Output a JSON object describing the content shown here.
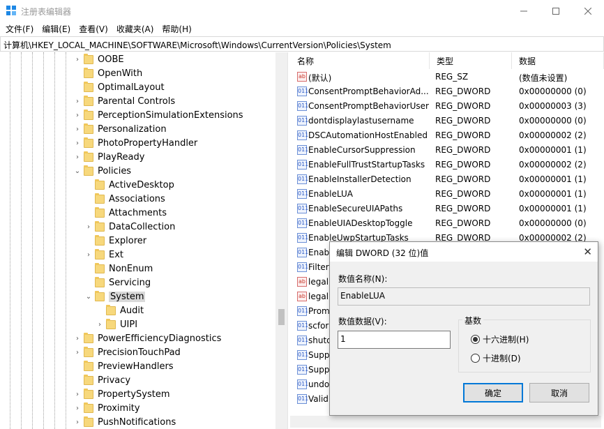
{
  "window": {
    "title": "注册表编辑器"
  },
  "menu": [
    "文件(F)",
    "编辑(E)",
    "查看(V)",
    "收藏夹(A)",
    "帮助(H)"
  ],
  "address": "计算机\\HKEY_LOCAL_MACHINE\\SOFTWARE\\Microsoft\\Windows\\CurrentVersion\\Policies\\System",
  "tree": [
    {
      "label": "OOBE",
      "level": 0,
      "chevron": "right"
    },
    {
      "label": "OpenWith",
      "level": 0,
      "chevron": ""
    },
    {
      "label": "OptimalLayout",
      "level": 0,
      "chevron": ""
    },
    {
      "label": "Parental Controls",
      "level": 0,
      "chevron": "right"
    },
    {
      "label": "PerceptionSimulationExtensions",
      "level": 0,
      "chevron": "right"
    },
    {
      "label": "Personalization",
      "level": 0,
      "chevron": "right"
    },
    {
      "label": "PhotoPropertyHandler",
      "level": 0,
      "chevron": "right"
    },
    {
      "label": "PlayReady",
      "level": 0,
      "chevron": "right"
    },
    {
      "label": "Policies",
      "level": 0,
      "chevron": "down"
    },
    {
      "label": "ActiveDesktop",
      "level": 1,
      "chevron": ""
    },
    {
      "label": "Associations",
      "level": 1,
      "chevron": ""
    },
    {
      "label": "Attachments",
      "level": 1,
      "chevron": ""
    },
    {
      "label": "DataCollection",
      "level": 1,
      "chevron": "right"
    },
    {
      "label": "Explorer",
      "level": 1,
      "chevron": ""
    },
    {
      "label": "Ext",
      "level": 1,
      "chevron": "right"
    },
    {
      "label": "NonEnum",
      "level": 1,
      "chevron": ""
    },
    {
      "label": "Servicing",
      "level": 1,
      "chevron": ""
    },
    {
      "label": "System",
      "level": 1,
      "chevron": "down",
      "selected": true
    },
    {
      "label": "Audit",
      "level": 2,
      "chevron": ""
    },
    {
      "label": "UIPI",
      "level": 2,
      "chevron": "right"
    },
    {
      "label": "PowerEfficiencyDiagnostics",
      "level": 0,
      "chevron": "right"
    },
    {
      "label": "PrecisionTouchPad",
      "level": 0,
      "chevron": "right"
    },
    {
      "label": "PreviewHandlers",
      "level": 0,
      "chevron": ""
    },
    {
      "label": "Privacy",
      "level": 0,
      "chevron": ""
    },
    {
      "label": "PropertySystem",
      "level": 0,
      "chevron": "right"
    },
    {
      "label": "Proximity",
      "level": 0,
      "chevron": "right"
    },
    {
      "label": "PushNotifications",
      "level": 0,
      "chevron": "right"
    }
  ],
  "list": {
    "headers": {
      "name": "名称",
      "type": "类型",
      "data": "数据"
    },
    "rows": [
      {
        "name": "(默认)",
        "type": "REG_SZ",
        "data": "(数值未设置)",
        "icon": "ab"
      },
      {
        "name": "ConsentPromptBehaviorAd...",
        "type": "REG_DWORD",
        "data": "0x00000000 (0)",
        "icon": "dw"
      },
      {
        "name": "ConsentPromptBehaviorUser",
        "type": "REG_DWORD",
        "data": "0x00000003 (3)",
        "icon": "dw"
      },
      {
        "name": "dontdisplaylastusername",
        "type": "REG_DWORD",
        "data": "0x00000000 (0)",
        "icon": "dw"
      },
      {
        "name": "DSCAutomationHostEnabled",
        "type": "REG_DWORD",
        "data": "0x00000002 (2)",
        "icon": "dw"
      },
      {
        "name": "EnableCursorSuppression",
        "type": "REG_DWORD",
        "data": "0x00000001 (1)",
        "icon": "dw"
      },
      {
        "name": "EnableFullTrustStartupTasks",
        "type": "REG_DWORD",
        "data": "0x00000002 (2)",
        "icon": "dw"
      },
      {
        "name": "EnableInstallerDetection",
        "type": "REG_DWORD",
        "data": "0x00000001 (1)",
        "icon": "dw"
      },
      {
        "name": "EnableLUA",
        "type": "REG_DWORD",
        "data": "0x00000001 (1)",
        "icon": "dw"
      },
      {
        "name": "EnableSecureUIAPaths",
        "type": "REG_DWORD",
        "data": "0x00000001 (1)",
        "icon": "dw"
      },
      {
        "name": "EnableUIADesktopToggle",
        "type": "REG_DWORD",
        "data": "0x00000000 (0)",
        "icon": "dw"
      },
      {
        "name": "EnableUwpStartupTasks",
        "type": "REG_DWORD",
        "data": "0x00000002 (2)",
        "icon": "dw"
      },
      {
        "name": "Enab",
        "type": "",
        "data": "",
        "icon": "dw"
      },
      {
        "name": "Filter",
        "type": "",
        "data": "",
        "icon": "dw"
      },
      {
        "name": "legal",
        "type": "",
        "data": "",
        "icon": "ab"
      },
      {
        "name": "legal",
        "type": "",
        "data": "",
        "icon": "ab"
      },
      {
        "name": "Prom",
        "type": "",
        "data": "",
        "icon": "dw"
      },
      {
        "name": "scfor",
        "type": "",
        "data": "",
        "icon": "dw"
      },
      {
        "name": "shutd",
        "type": "",
        "data": "",
        "icon": "dw"
      },
      {
        "name": "Supp",
        "type": "",
        "data": "",
        "icon": "dw"
      },
      {
        "name": "Supp",
        "type": "",
        "data": "",
        "icon": "dw"
      },
      {
        "name": "undo",
        "type": "",
        "data": "",
        "icon": "dw"
      },
      {
        "name": "Valid",
        "type": "",
        "data": "",
        "icon": "dw"
      }
    ]
  },
  "dialog": {
    "title": "编辑 DWORD (32 位)值",
    "name_label": "数值名称(N):",
    "name_value": "EnableLUA",
    "data_label": "数值数据(V):",
    "data_value": "1",
    "base_label": "基数",
    "hex_label": "十六进制(H)",
    "dec_label": "十进制(D)",
    "selected_base": "hex",
    "ok": "确定",
    "cancel": "取消"
  }
}
